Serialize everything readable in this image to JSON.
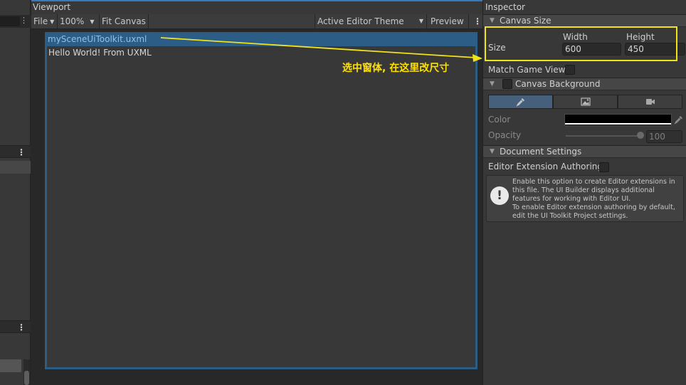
{
  "viewport": {
    "title": "Viewport",
    "toolbar": {
      "file_label": "File",
      "zoom_label": "100%",
      "fit_canvas_label": "Fit Canvas",
      "theme_label": "Active Editor Theme",
      "preview_label": "Preview"
    },
    "document": {
      "file_name": "mySceneUiToolkit.uxml",
      "label_text": "Hello World! From UXML"
    },
    "annotation_text": "选中窗体, 在这里改尺寸"
  },
  "inspector": {
    "title": "Inspector",
    "canvas_size": {
      "header": "Canvas Size",
      "size_label": "Size",
      "width_label": "Width",
      "height_label": "Height",
      "width_value": "600",
      "height_value": "450",
      "match_game_view_label": "Match Game View"
    },
    "canvas_background": {
      "header": "Canvas Background",
      "color_label": "Color",
      "opacity_label": "Opacity",
      "opacity_value": "100",
      "color_value": "#000000"
    },
    "document_settings": {
      "header": "Document Settings",
      "editor_extension_label": "Editor Extension Authoring",
      "help_lines": [
        "Enable this option to create Editor extensions in",
        "this file. The UI Builder displays additional",
        "features for working with Editor UI.",
        "To enable Editor extension authoring by default,",
        "edit the UI Toolkit Project settings."
      ]
    }
  },
  "colors": {
    "accent": "#2c5d87",
    "annotation": "#ffe000",
    "highlight_box": "#f2e21a"
  }
}
